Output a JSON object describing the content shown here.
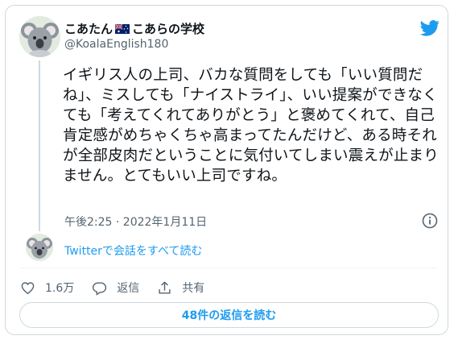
{
  "tweet": {
    "display_name_left": "こあたん",
    "display_name_right": "こあらの学校",
    "flag_icon": "australia-flag-icon",
    "handle": "@KoalaEnglish180",
    "text": "イギリス人の上司、バカな質問をしても「いい質問だね」、ミスしても「ナイストライ」、いい提案ができなくても「考えてくれてありがとう」と褒めてくれて、自己肯定感がめちゃくちゃ高まってたんだけど、ある時それが全部皮肉だということに気付いてしまい震えが止まりません。とてもいい上司ですね。",
    "timestamp": "午後2:25 · 2022年1月11日"
  },
  "thread": {
    "read_label": "Twitterで会話をすべて読む"
  },
  "actions": {
    "like_count": "1.6万",
    "reply_label": "返信",
    "share_label": "共有"
  },
  "replies_button": "48件の返信を読む",
  "colors": {
    "accent": "#1d9bf0",
    "secondary_text": "#536471",
    "border": "#cfd9de"
  },
  "icons": [
    "twitter-bird-icon",
    "info-icon",
    "heart-icon",
    "reply-icon",
    "share-icon",
    "koala-avatar"
  ]
}
